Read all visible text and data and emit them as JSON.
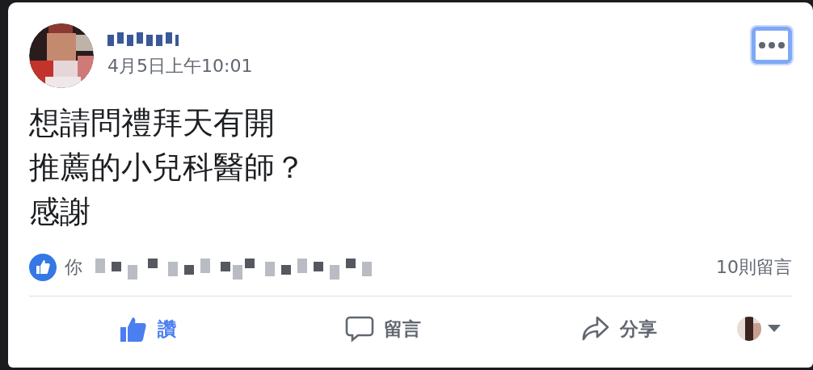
{
  "post": {
    "timestamp": "4月5日上午10:01",
    "text_lines": [
      "想請問禮拜天有開",
      "推薦的小兒科醫師？",
      "感謝"
    ]
  },
  "reactions": {
    "prefix": "你",
    "comment_count": "10則留言"
  },
  "actions": [
    {
      "kind": "like",
      "label": "讚",
      "selected": true
    },
    {
      "kind": "comment",
      "label": "留言",
      "selected": false
    },
    {
      "kind": "share",
      "label": "分享",
      "selected": false
    }
  ]
}
